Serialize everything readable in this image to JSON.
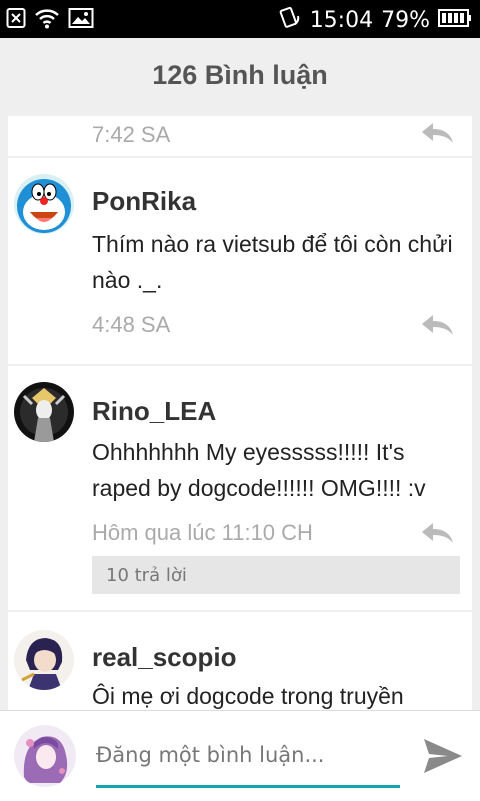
{
  "status_bar": {
    "time": "15:04",
    "battery_percent": "79%",
    "icons": [
      "close-box-icon",
      "wifi-icon",
      "image-icon",
      "rotate-lock-icon",
      "battery-icon"
    ]
  },
  "header": {
    "title": "126 Bình luận"
  },
  "comments": [
    {
      "timestamp": "7:42 SA"
    },
    {
      "username": "PonRika",
      "text": "Thím nào ra vietsub để tôi còn chửi nào ._.",
      "timestamp": "4:48 SA"
    },
    {
      "username": "Rino_LEA",
      "text": "Ohhhhhhh My eyesssss!!!!! It's raped by dogcode!!!!!! OMG!!!! :v",
      "timestamp": "Hôm qua lúc 11:10 CH",
      "replies": "10 trả lời"
    },
    {
      "username": "real_scopio",
      "text": "Ôi mẹ ơi dogcode trong truyền"
    }
  ],
  "composer": {
    "placeholder": "Đăng một bình luận...",
    "send_icon": "send-icon"
  },
  "colors": {
    "accent": "#18a3ad",
    "background": "#efefef",
    "timestamp": "#aaaaaa"
  }
}
